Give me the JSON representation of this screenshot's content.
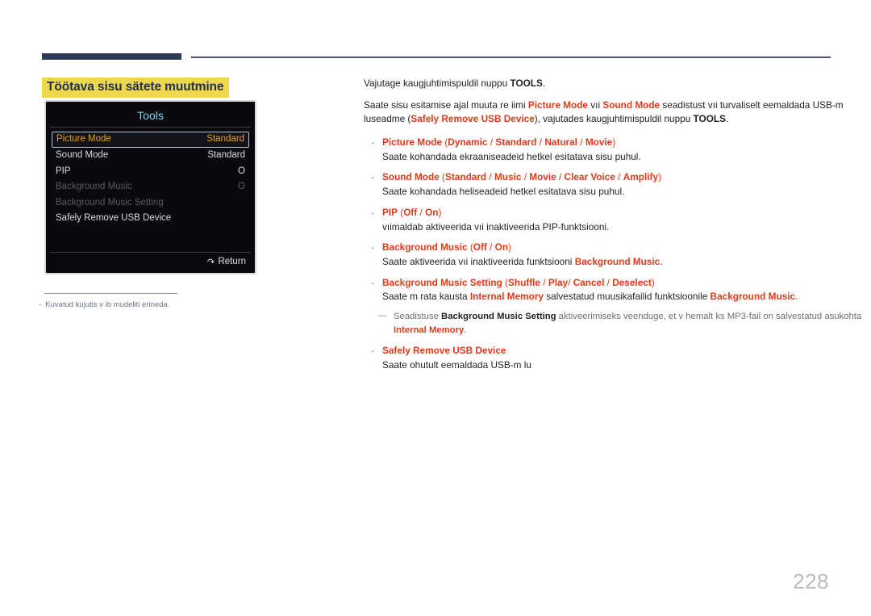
{
  "header": {
    "bar_color": "#2e3a58",
    "line_color": "#454f6e"
  },
  "section": {
    "title": "Töötava sisu sätete muutmine",
    "highlight_color": "#edd74b",
    "title_color": "#21304f"
  },
  "osd": {
    "title": "Tools",
    "title_color": "#7fd8ec",
    "selected_color": "#e8a020",
    "rows": [
      {
        "label": "Picture Mode",
        "value": "Standard",
        "state": "selected"
      },
      {
        "label": "Sound Mode",
        "value": "Standard",
        "state": "normal"
      },
      {
        "label": "PIP",
        "value": "O",
        "state": "normal"
      },
      {
        "label": "Background Music",
        "value": "O",
        "state": "dim"
      },
      {
        "label": "Background Music Setting",
        "value": "",
        "state": "dim"
      },
      {
        "label": "Safely Remove USB Device",
        "value": "",
        "state": "normal"
      }
    ],
    "footer": {
      "return_label": "Return",
      "return_icon": "return-arrow-icon"
    }
  },
  "footnote": {
    "dash": "-",
    "text": "Kuvatud kujutis v ib mudeliti erineda."
  },
  "content": {
    "intro_1": {
      "pre": "Vajutage kaugjuhtimispuldil nuppu ",
      "bold": "TOOLS",
      "post": "."
    },
    "intro_2": {
      "s1": "Saate sisu esitamise ajal muuta re iimi ",
      "r1": "Picture Mode",
      "s2": " vıi ",
      "r2": "Sound Mode",
      "s3": " seadistust vıi turvaliselt eemaldada USB-m luseadme (",
      "r3": "Safely Remove USB Device",
      "s4": "), vajutades kaugjuhtimispuldil nuppu ",
      "b1": "TOOLS",
      "s5": "."
    },
    "bullets": [
      {
        "name": "Picture Mode",
        "options_open": " (",
        "options": [
          "Dynamic",
          "Standard",
          "Natural",
          "Movie"
        ],
        "options_close": ")",
        "body": "Saate kohandada ekraaniseadeid hetkel esitatava sisu puhul."
      },
      {
        "name": "Sound Mode",
        "options_open": " (",
        "options": [
          "Standard",
          "Music",
          "Movie",
          "Clear Voice",
          "Amplify"
        ],
        "options_close": ")",
        "body": "Saate kohandada heliseadeid hetkel esitatava sisu puhul."
      },
      {
        "name": "PIP",
        "options_open": " (",
        "options": [
          "Off",
          "On"
        ],
        "options_close": ")",
        "body": "vıimaldab aktiveerida vıi inaktiveerida PIP-funktsiooni."
      },
      {
        "name": "Background Music",
        "options_open": " (",
        "options": [
          "Off",
          "On"
        ],
        "options_close": ")",
        "body_pre": "Saate aktiveerida vıi inaktiveerida funktsiooni ",
        "body_term": "Background Music",
        "body_post": "."
      },
      {
        "name": "Background Music Setting",
        "options_open": " (",
        "options": [
          "Shuffle",
          "Play",
          "Cancel",
          "Deselect"
        ],
        "options_close": ")",
        "body_pre": "Saate m rata kausta ",
        "body_term1": "Internal Memory",
        "body_mid": " salvestatud muusikafailid funktsioonile ",
        "body_term2": "Background Music",
        "body_post": "."
      },
      {
        "name": "Safely Remove USB Device",
        "body": "Saate ohutult eemaldada USB-m lu"
      }
    ],
    "subnote": {
      "s1": "Seadistuse ",
      "b1": "Background Music Setting",
      "s2": " aktiveerimiseks veenduge, et v hemalt  ks MP3-fail on salvestatud asukohta ",
      "r1": "Internal Memory",
      "s3": "."
    }
  },
  "page": {
    "number": "228"
  }
}
